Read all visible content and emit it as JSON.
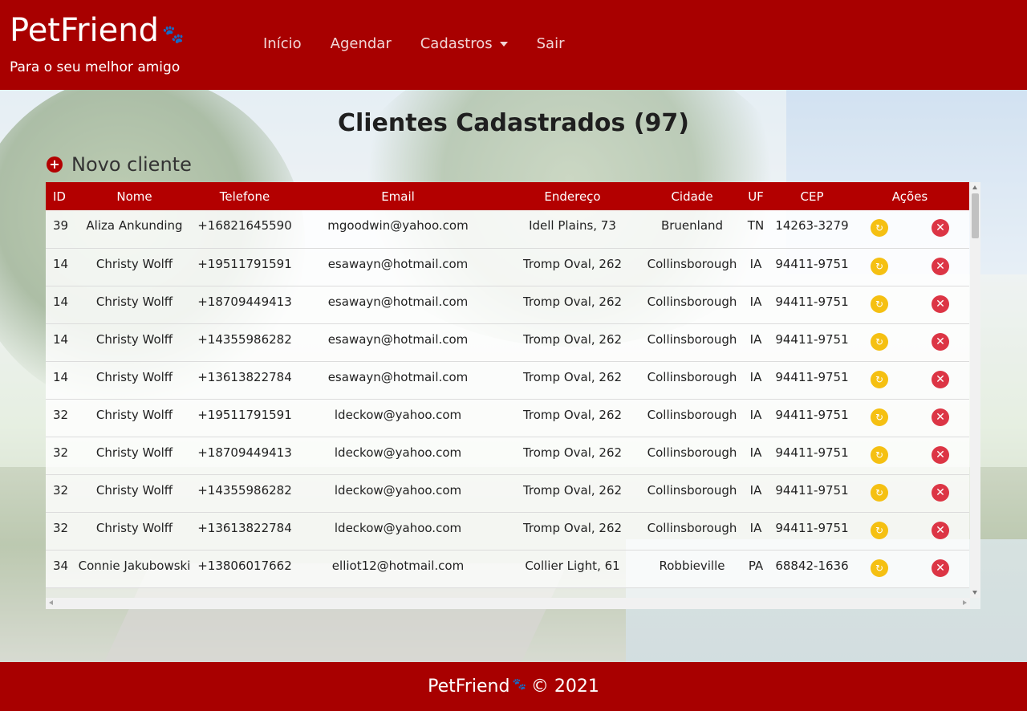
{
  "header": {
    "brand": "PetFriend",
    "brand_paw_icon": "paw-icon",
    "tagline": "Para o seu melhor amigo",
    "nav": [
      {
        "label": "Início"
      },
      {
        "label": "Agendar"
      },
      {
        "label": "Cadastros",
        "dropdown": true
      },
      {
        "label": "Sair"
      }
    ],
    "color": "#a80000"
  },
  "main": {
    "title": "Clientes Cadastrados (97)",
    "new_button": "Novo cliente",
    "table": {
      "columns": [
        "ID",
        "Nome",
        "Telefone",
        "Email",
        "Endereço",
        "Cidade",
        "UF",
        "CEP",
        "Ações"
      ],
      "rows": [
        [
          "39",
          "Aliza Ankunding",
          "+16821645590",
          "mgoodwin@yahoo.com",
          "Idell Plains, 73",
          "Bruenland",
          "TN",
          "14263-3279"
        ],
        [
          "14",
          "Christy Wolff",
          "+19511791591",
          "esawayn@hotmail.com",
          "Tromp Oval, 262",
          "Collinsborough",
          "IA",
          "94411-9751"
        ],
        [
          "14",
          "Christy Wolff",
          "+18709449413",
          "esawayn@hotmail.com",
          "Tromp Oval, 262",
          "Collinsborough",
          "IA",
          "94411-9751"
        ],
        [
          "14",
          "Christy Wolff",
          "+14355986282",
          "esawayn@hotmail.com",
          "Tromp Oval, 262",
          "Collinsborough",
          "IA",
          "94411-9751"
        ],
        [
          "14",
          "Christy Wolff",
          "+13613822784",
          "esawayn@hotmail.com",
          "Tromp Oval, 262",
          "Collinsborough",
          "IA",
          "94411-9751"
        ],
        [
          "32",
          "Christy Wolff",
          "+19511791591",
          "ldeckow@yahoo.com",
          "Tromp Oval, 262",
          "Collinsborough",
          "IA",
          "94411-9751"
        ],
        [
          "32",
          "Christy Wolff",
          "+18709449413",
          "ldeckow@yahoo.com",
          "Tromp Oval, 262",
          "Collinsborough",
          "IA",
          "94411-9751"
        ],
        [
          "32",
          "Christy Wolff",
          "+14355986282",
          "ldeckow@yahoo.com",
          "Tromp Oval, 262",
          "Collinsborough",
          "IA",
          "94411-9751"
        ],
        [
          "32",
          "Christy Wolff",
          "+13613822784",
          "ldeckow@yahoo.com",
          "Tromp Oval, 262",
          "Collinsborough",
          "IA",
          "94411-9751"
        ],
        [
          "34",
          "Connie Jakubowski",
          "+13806017662",
          "elliot12@hotmail.com",
          "Collier Light, 61",
          "Robbieville",
          "PA",
          "68842-1636"
        ]
      ],
      "actions": {
        "edit_icon": "refresh-icon",
        "delete_icon": "close-icon",
        "edit_color": "#f5c012",
        "delete_color": "#dc3545"
      }
    }
  },
  "footer": {
    "brand": "PetFriend",
    "copyright": "© 2021"
  }
}
